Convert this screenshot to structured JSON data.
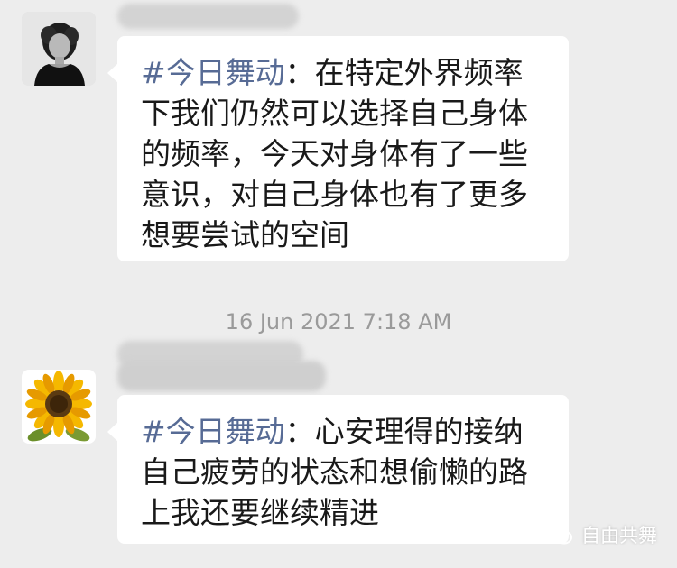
{
  "messages": [
    {
      "sender_name": "宋",
      "hashtag": "#今日舞动",
      "text": "：在特定外界频率下我们仍然可以选择自己身体的频率，今天对身体有了一些意识，对自己身体也有了更多想要尝试的空间",
      "avatar": "person-photo"
    },
    {
      "sender_name": "",
      "hashtag": "#今日舞动",
      "text": "：心安理得的接纳自己疲劳的状态和想偷懒的路上我还要继续精进",
      "avatar": "sunflower-photo"
    }
  ],
  "timestamp": "16 Jun 2021 7:18 AM",
  "watermark": {
    "label": "自由共舞",
    "icon": "wechat-icon"
  },
  "colors": {
    "background": "#ededed",
    "bubble": "#ffffff",
    "hashtag": "#576b95",
    "text": "#191919",
    "timestamp": "#9a9a9a"
  }
}
